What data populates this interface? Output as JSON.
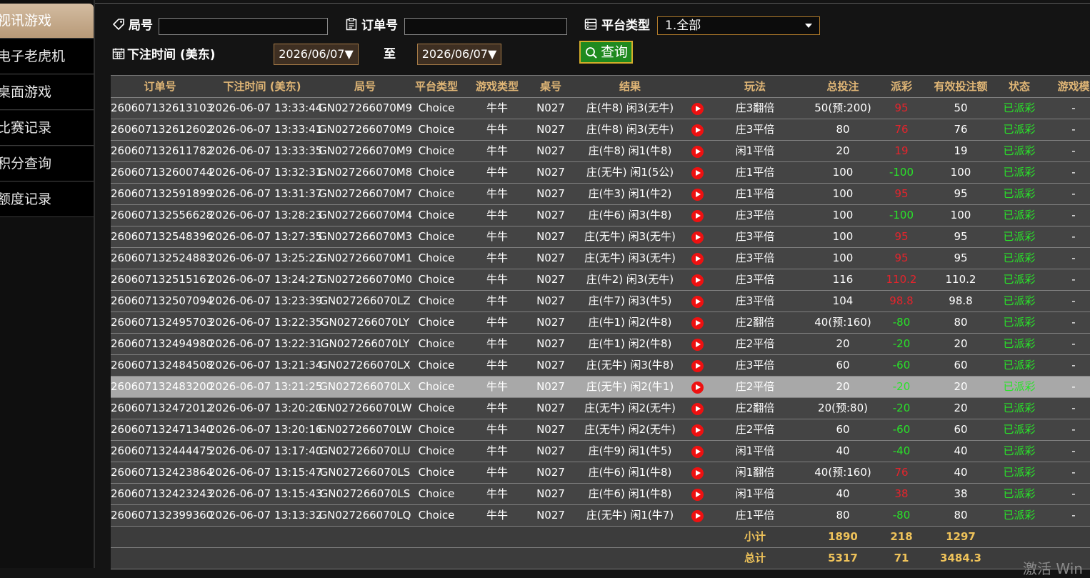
{
  "sidebar": {
    "items": [
      {
        "label": "视讯游戏",
        "active": true
      },
      {
        "label": "电子老虎机",
        "active": false
      },
      {
        "label": "桌面游戏",
        "active": false
      },
      {
        "label": "比赛记录",
        "active": false
      },
      {
        "label": "积分查询",
        "active": false
      },
      {
        "label": "额度记录",
        "active": false
      }
    ]
  },
  "filters": {
    "round_label": "局号",
    "round_value": "",
    "order_label": "订单号",
    "order_value": "",
    "platform_label": "平台类型",
    "platform_selected": "1.全部",
    "bet_time_label": "下注时间 (美东)",
    "date_from": "2026/06/07▼",
    "to_label": "至",
    "date_to": "2026/06/07▼",
    "query_label": "查询"
  },
  "table": {
    "columns": [
      "订单号",
      "下注时间 (美东)",
      "局号",
      "平台类型",
      "游戏类型",
      "桌号",
      "结果",
      "",
      "玩法",
      "总投注",
      "派彩",
      "有效投注额",
      "状态",
      "游戏模"
    ],
    "rows": [
      {
        "order": "260607132613103",
        "time": "2026-06-07 13:33:44",
        "round": "GN027266070M9",
        "platform": "Choice",
        "game": "牛牛",
        "table": "N027",
        "result": "庄(牛8) 闲3(无牛)",
        "play": "庄3翻倍",
        "bet": "50(预:200)",
        "payout": "95",
        "payout_color": "red",
        "valid": "50",
        "status": "已派彩",
        "mode": "-"
      },
      {
        "order": "260607132612602",
        "time": "2026-06-07 13:33:41",
        "round": "GN027266070M9",
        "platform": "Choice",
        "game": "牛牛",
        "table": "N027",
        "result": "庄(牛8) 闲3(无牛)",
        "play": "庄3平倍",
        "bet": "80",
        "payout": "76",
        "payout_color": "red",
        "valid": "76",
        "status": "已派彩",
        "mode": "-"
      },
      {
        "order": "260607132611782",
        "time": "2026-06-07 13:33:35",
        "round": "GN027266070M9",
        "platform": "Choice",
        "game": "牛牛",
        "table": "N027",
        "result": "庄(牛8) 闲1(牛8)",
        "play": "闲1平倍",
        "bet": "20",
        "payout": "19",
        "payout_color": "red",
        "valid": "19",
        "status": "已派彩",
        "mode": "-"
      },
      {
        "order": "260607132600744",
        "time": "2026-06-07 13:32:31",
        "round": "GN027266070M8",
        "platform": "Choice",
        "game": "牛牛",
        "table": "N027",
        "result": "庄(无牛) 闲1(5公)",
        "play": "庄1平倍",
        "bet": "100",
        "payout": "-100",
        "payout_color": "green",
        "valid": "100",
        "status": "已派彩",
        "mode": "-"
      },
      {
        "order": "260607132591899",
        "time": "2026-06-07 13:31:37",
        "round": "GN027266070M7",
        "platform": "Choice",
        "game": "牛牛",
        "table": "N027",
        "result": "庄(牛3) 闲1(牛2)",
        "play": "庄1平倍",
        "bet": "100",
        "payout": "95",
        "payout_color": "red",
        "valid": "95",
        "status": "已派彩",
        "mode": "-"
      },
      {
        "order": "260607132556628",
        "time": "2026-06-07 13:28:23",
        "round": "GN027266070M4",
        "platform": "Choice",
        "game": "牛牛",
        "table": "N027",
        "result": "庄(牛6) 闲3(牛8)",
        "play": "庄3平倍",
        "bet": "100",
        "payout": "-100",
        "payout_color": "green",
        "valid": "100",
        "status": "已派彩",
        "mode": "-"
      },
      {
        "order": "260607132548396",
        "time": "2026-06-07 13:27:35",
        "round": "GN027266070M3",
        "platform": "Choice",
        "game": "牛牛",
        "table": "N027",
        "result": "庄(无牛) 闲3(无牛)",
        "play": "庄3平倍",
        "bet": "100",
        "payout": "95",
        "payout_color": "red",
        "valid": "95",
        "status": "已派彩",
        "mode": "-"
      },
      {
        "order": "260607132524883",
        "time": "2026-06-07 13:25:22",
        "round": "GN027266070M1",
        "platform": "Choice",
        "game": "牛牛",
        "table": "N027",
        "result": "庄(无牛) 闲3(无牛)",
        "play": "庄3平倍",
        "bet": "100",
        "payout": "95",
        "payout_color": "red",
        "valid": "95",
        "status": "已派彩",
        "mode": "-"
      },
      {
        "order": "260607132515167",
        "time": "2026-06-07 13:24:27",
        "round": "GN027266070M0",
        "platform": "Choice",
        "game": "牛牛",
        "table": "N027",
        "result": "庄(牛2) 闲3(无牛)",
        "play": "庄3平倍",
        "bet": "116",
        "payout": "110.2",
        "payout_color": "red",
        "valid": "110.2",
        "status": "已派彩",
        "mode": "-"
      },
      {
        "order": "260607132507094",
        "time": "2026-06-07 13:23:39",
        "round": "GN027266070LZ",
        "platform": "Choice",
        "game": "牛牛",
        "table": "N027",
        "result": "庄(牛7) 闲3(牛5)",
        "play": "庄3平倍",
        "bet": "104",
        "payout": "98.8",
        "payout_color": "red",
        "valid": "98.8",
        "status": "已派彩",
        "mode": "-"
      },
      {
        "order": "260607132495703",
        "time": "2026-06-07 13:22:35",
        "round": "GN027266070LY",
        "platform": "Choice",
        "game": "牛牛",
        "table": "N027",
        "result": "庄(牛1) 闲2(牛8)",
        "play": "庄2翻倍",
        "bet": "40(预:160)",
        "payout": "-80",
        "payout_color": "green",
        "valid": "80",
        "status": "已派彩",
        "mode": "-"
      },
      {
        "order": "260607132494980",
        "time": "2026-06-07 13:22:31",
        "round": "GN027266070LY",
        "platform": "Choice",
        "game": "牛牛",
        "table": "N027",
        "result": "庄(牛1) 闲2(牛8)",
        "play": "庄2平倍",
        "bet": "20",
        "payout": "-20",
        "payout_color": "green",
        "valid": "20",
        "status": "已派彩",
        "mode": "-"
      },
      {
        "order": "260607132484508",
        "time": "2026-06-07 13:21:34",
        "round": "GN027266070LX",
        "platform": "Choice",
        "game": "牛牛",
        "table": "N027",
        "result": "庄(无牛) 闲3(牛8)",
        "play": "庄3平倍",
        "bet": "60",
        "payout": "-60",
        "payout_color": "green",
        "valid": "60",
        "status": "已派彩",
        "mode": "-"
      },
      {
        "order": "260607132483200",
        "time": "2026-06-07 13:21:25",
        "round": "GN027266070LX",
        "platform": "Choice",
        "game": "牛牛",
        "table": "N027",
        "result": "庄(无牛) 闲2(牛1)",
        "play": "庄2平倍",
        "bet": "20",
        "payout": "-20",
        "payout_color": "green",
        "valid": "20",
        "status": "已派彩",
        "mode": "-",
        "selected": true
      },
      {
        "order": "260607132472012",
        "time": "2026-06-07 13:20:20",
        "round": "GN027266070LW",
        "platform": "Choice",
        "game": "牛牛",
        "table": "N027",
        "result": "庄(无牛) 闲2(无牛)",
        "play": "庄2翻倍",
        "bet": "20(预:80)",
        "payout": "-20",
        "payout_color": "green",
        "valid": "20",
        "status": "已派彩",
        "mode": "-"
      },
      {
        "order": "260607132471340",
        "time": "2026-06-07 13:20:16",
        "round": "GN027266070LW",
        "platform": "Choice",
        "game": "牛牛",
        "table": "N027",
        "result": "庄(无牛) 闲2(无牛)",
        "play": "庄2平倍",
        "bet": "60",
        "payout": "-60",
        "payout_color": "green",
        "valid": "60",
        "status": "已派彩",
        "mode": "-"
      },
      {
        "order": "260607132444475",
        "time": "2026-06-07 13:17:40",
        "round": "GN027266070LU",
        "platform": "Choice",
        "game": "牛牛",
        "table": "N027",
        "result": "庄(牛9) 闲1(牛5)",
        "play": "闲1平倍",
        "bet": "40",
        "payout": "-40",
        "payout_color": "green",
        "valid": "40",
        "status": "已派彩",
        "mode": "-"
      },
      {
        "order": "260607132423864",
        "time": "2026-06-07 13:15:47",
        "round": "GN027266070LS",
        "platform": "Choice",
        "game": "牛牛",
        "table": "N027",
        "result": "庄(牛6) 闲1(牛8)",
        "play": "闲1翻倍",
        "bet": "40(预:160)",
        "payout": "76",
        "payout_color": "red",
        "valid": "40",
        "status": "已派彩",
        "mode": "-"
      },
      {
        "order": "260607132423243",
        "time": "2026-06-07 13:15:43",
        "round": "GN027266070LS",
        "platform": "Choice",
        "game": "牛牛",
        "table": "N027",
        "result": "庄(牛6) 闲1(牛8)",
        "play": "闲1平倍",
        "bet": "40",
        "payout": "38",
        "payout_color": "red",
        "valid": "38",
        "status": "已派彩",
        "mode": "-"
      },
      {
        "order": "260607132399360",
        "time": "2026-06-07 13:13:32",
        "round": "GN027266070LQ",
        "platform": "Choice",
        "game": "牛牛",
        "table": "N027",
        "result": "庄(无牛) 闲1(牛7)",
        "play": "庄1平倍",
        "bet": "80",
        "payout": "-80",
        "payout_color": "green",
        "valid": "80",
        "status": "已派彩",
        "mode": "-"
      }
    ],
    "subtotal": {
      "label": "小计",
      "bet": "1890",
      "payout": "218",
      "valid": "1297"
    },
    "total": {
      "label": "总计",
      "bet": "5317",
      "payout": "71",
      "valid": "3484.3"
    }
  },
  "watermark": "激活 Win",
  "colors": {
    "accent": "#c4a27e",
    "payout_win": "#e5242c",
    "payout_loss": "#29e329",
    "status": "#29e329",
    "header_text": "#e0b676",
    "query_button": "#1f8a1f"
  }
}
